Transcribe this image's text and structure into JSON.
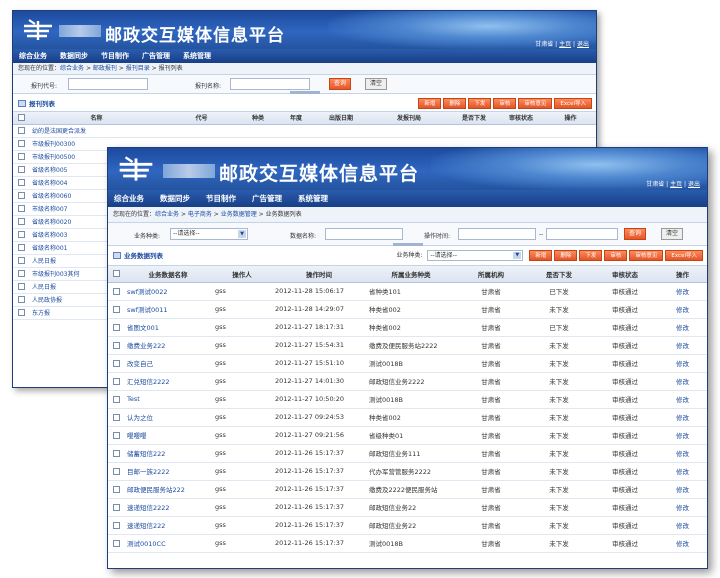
{
  "app": {
    "title": "邮政交互媒体信息平台",
    "user_region": "甘肃省",
    "user_link_1": "主页",
    "user_link_2": "退出",
    "nav": [
      "综合业务",
      "数据同步",
      "节目制作",
      "广告管理",
      "系统管理"
    ]
  },
  "back_window": {
    "breadcrumb": {
      "prefix": "您现在的位置：",
      "parts": [
        "综合业务",
        "邮政报刊",
        "报刊目录",
        "报刊列表"
      ],
      "separator": " > "
    },
    "search": {
      "label_code": "报刊代号:",
      "label_name": "报刊名称:",
      "query_button": "查询",
      "clear_button": "清空"
    },
    "list_title": "报刊列表",
    "toolbar": [
      "新增",
      "删除",
      "下发",
      "审核",
      "审核意见",
      "Excel导入"
    ],
    "columns": [
      "名称",
      "代号",
      "种类",
      "年度",
      "出版日期",
      "发报刊局",
      "是否下发",
      "审核状态",
      "操作"
    ],
    "rows": [
      "幼的是法国更合派发",
      "市级报刊00300",
      "市级报刊00500",
      "省级名称005",
      "省级名称004",
      "省级名称0060",
      "市级名称007",
      "省级名称0020",
      "省级名称003",
      "省级名称001",
      "人民日报",
      "市级报刊003其何",
      "人民日报",
      "人民政协报",
      "东方报"
    ]
  },
  "front_window": {
    "breadcrumb": {
      "prefix": "您现在的位置：",
      "parts": [
        "综合业务",
        "电子商务",
        "业务数据管理",
        "业务数据列表"
      ],
      "separator": " > "
    },
    "search": {
      "label_type": "业务种类:",
      "type_placeholder": "--请选择--",
      "label_name": "数据名称:",
      "label_time": "操作时间:",
      "time_sep": "--",
      "query_button": "查询",
      "clear_button": "清空"
    },
    "list_title": "业务数据列表",
    "toolbar_type_label": "业务种类:",
    "toolbar_type_placeholder": "--请选择--",
    "toolbar": [
      "新增",
      "删除",
      "下发",
      "审核",
      "审核意见",
      "Excel导入"
    ],
    "columns": [
      "业务数据名称",
      "操作人",
      "操作时间",
      "所属业务种类",
      "所属机构",
      "是否下发",
      "审核状态",
      "操作"
    ],
    "rows": [
      [
        "swf测试0022",
        "gss",
        "2012-11-28 15:06:17",
        "省种类101",
        "甘肃省",
        "已下发",
        "审核通过",
        "修改"
      ],
      [
        "swf测试0011",
        "gss",
        "2012-11-28 14:29:07",
        "种类省002",
        "甘肃省",
        "未下发",
        "审核通过",
        "修改"
      ],
      [
        "省图文001",
        "gss",
        "2012-11-27 18:17:31",
        "种类省002",
        "甘肃省",
        "已下发",
        "审核通过",
        "修改"
      ],
      [
        "缴费业务222",
        "gss",
        "2012-11-27 15:54:31",
        "缴费及便民服务站2222",
        "甘肃省",
        "未下发",
        "审核通过",
        "修改"
      ],
      [
        "改变自己",
        "gss",
        "2012-11-27 15:51:10",
        "测试0018B",
        "甘肃省",
        "未下发",
        "审核通过",
        "修改"
      ],
      [
        "汇兑短信2222",
        "gss",
        "2012-11-27 14:01:30",
        "邮政短信业务2222",
        "甘肃省",
        "未下发",
        "审核通过",
        "修改"
      ],
      [
        "Test",
        "gss",
        "2012-11-27 10:50:20",
        "测试0018B",
        "甘肃省",
        "未下发",
        "审核通过",
        "修改"
      ],
      [
        "认为之位",
        "gss",
        "2012-11-27 09:24:53",
        "种类省002",
        "甘肃省",
        "未下发",
        "审核通过",
        "修改"
      ],
      [
        "嘤嘤嘤",
        "gss",
        "2012-11-27 09:21:56",
        "省级种类01",
        "甘肃省",
        "未下发",
        "审核通过",
        "修改"
      ],
      [
        "储蓄短信222",
        "gss",
        "2012-11-26 15:17:37",
        "邮政短信业务111",
        "甘肃省",
        "未下发",
        "审核通过",
        "修改"
      ],
      [
        "目邮一族2222",
        "gss",
        "2012-11-26 15:17:37",
        "代办军营管服务2222",
        "甘肃省",
        "未下发",
        "审核通过",
        "修改"
      ],
      [
        "邮政便民服务站222",
        "gss",
        "2012-11-26 15:17:37",
        "缴费及2222便民服务站",
        "甘肃省",
        "未下发",
        "审核通过",
        "修改"
      ],
      [
        "速递短信2222",
        "gss",
        "2012-11-26 15:17:37",
        "邮政短信业务22",
        "甘肃省",
        "未下发",
        "审核通过",
        "修改"
      ],
      [
        "速递短信222",
        "gss",
        "2012-11-26 15:17:37",
        "邮政短信业务22",
        "甘肃省",
        "未下发",
        "审核通过",
        "修改"
      ],
      [
        "测试0010CC",
        "gss",
        "2012-11-26 15:17:37",
        "测试0018B",
        "甘肃省",
        "未下发",
        "审核通过",
        "修改"
      ]
    ]
  }
}
